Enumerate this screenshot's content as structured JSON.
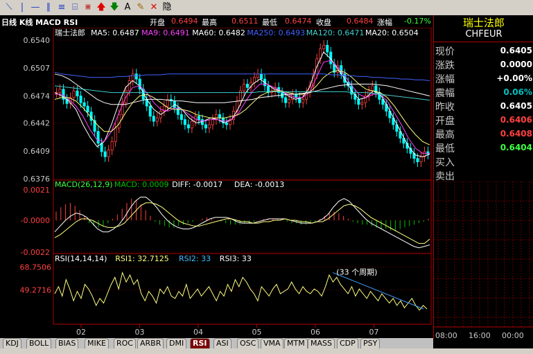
{
  "toolbar": {
    "icons": [
      "line-tool-icon",
      "vertical-line-icon",
      "horizontal-line-icon",
      "vertical-bars-icon",
      "parallel-lines-icon",
      "channel-icon",
      "fan-lines-icon",
      "arrow-up-icon",
      "arrow-down-icon",
      "text-icon",
      "eraser-icon",
      "delete-icon",
      "hide-icon"
    ],
    "glyphs": [
      "⟍",
      "|",
      "—",
      "∥",
      "≡",
      "⌸",
      "⋇",
      "🡅",
      "🡇",
      "A",
      "✎",
      "✕",
      "隐"
    ],
    "colors": [
      "#2040c0",
      "#2040c0",
      "#2040c0",
      "#2040c0",
      "#2040c0",
      "#2040c0",
      "#c02020",
      "#e00000",
      "#008000",
      "#000000",
      "#a06000",
      "#e00000",
      "#000000"
    ]
  },
  "header": {
    "chart_caption": "日线 K线 MACD RSI",
    "open_label": "开盘",
    "open_value": "0.6494",
    "high_label": "最高",
    "high_value": "0.6511",
    "low_label": "最低",
    "low_value": "0.6474",
    "close_label": "收盘",
    "close_value": "0.6484",
    "change_label": "涨幅",
    "change_value": "-0.17%"
  },
  "panel": {
    "name": "瑞士法郎",
    "code": "CHFEUR",
    "rows": [
      {
        "label": "现价",
        "value": "0.6405",
        "color": "#ffffff"
      },
      {
        "label": "涨跌",
        "value": "0.0000",
        "color": "#ffffff"
      },
      {
        "label": "涨幅",
        "value": "+0.00%",
        "color": "#ffffff"
      },
      {
        "label": "震幅",
        "value": "0.06%",
        "color": "#00c0c0"
      },
      {
        "label": "昨收",
        "value": "0.6405",
        "color": "#ffffff"
      },
      {
        "label": "开盘",
        "value": "0.6406",
        "color": "#ff4040"
      },
      {
        "label": "最高",
        "value": "0.6408",
        "color": "#ff4040"
      },
      {
        "label": "最低",
        "value": "0.6404",
        "color": "#40ff40"
      },
      {
        "label": "买入",
        "value": "",
        "color": "#ffffff"
      },
      {
        "label": "卖出",
        "value": "",
        "color": "#ffffff"
      }
    ],
    "time_labels": [
      "08:00",
      "16:00",
      "00:00"
    ]
  },
  "tabs": [
    "KDJ",
    "BOLL",
    "BIAS",
    "MIKE",
    "ROC",
    "ARBR",
    "DMI",
    "RSI",
    "ASI",
    "OSC",
    "VMA",
    "MTM",
    "MASS",
    "CDP",
    "PSY"
  ],
  "active_tab": "RSI",
  "chart_data": [
    {
      "type": "candlestick",
      "legend_name": "瑞士法郎",
      "ma_labels": [
        {
          "text": "MA5: 0.6487",
          "color": "#ffffff"
        },
        {
          "text": "MA9: 0.6491",
          "color": "#ff40ff"
        },
        {
          "text": "MA60: 0.6482",
          "color": "#ffffff"
        },
        {
          "text": "MA250: 0.6493",
          "color": "#4060ff"
        },
        {
          "text": "MA120: 0.6471",
          "color": "#40d0d0"
        },
        {
          "text": "MA20: 0.6504",
          "color": "#ffffff"
        }
      ],
      "y_ticks": [
        "0.6540",
        "0.6507",
        "0.6474",
        "0.6442",
        "0.6409",
        "0.6376"
      ],
      "ylim": [
        0.6376,
        0.654
      ],
      "x_ticks": [
        "02",
        "03",
        "04",
        "05",
        "06",
        "07"
      ],
      "close": [
        0.6478,
        0.6482,
        0.647,
        0.6465,
        0.6472,
        0.648,
        0.6474,
        0.6466,
        0.6462,
        0.6455,
        0.6445,
        0.6432,
        0.6418,
        0.6408,
        0.6402,
        0.641,
        0.642,
        0.6436,
        0.6452,
        0.6466,
        0.648,
        0.6492,
        0.65,
        0.6494,
        0.6482,
        0.647,
        0.6462,
        0.645,
        0.6444,
        0.6448,
        0.6456,
        0.6462,
        0.647,
        0.6468,
        0.646,
        0.6452,
        0.6446,
        0.644,
        0.6436,
        0.6444,
        0.645,
        0.6446,
        0.644,
        0.6436,
        0.644,
        0.6446,
        0.6452,
        0.6448,
        0.6442,
        0.644,
        0.6446,
        0.6456,
        0.6468,
        0.648,
        0.6488,
        0.6484,
        0.649,
        0.6496,
        0.65,
        0.6494,
        0.6486,
        0.6478,
        0.648,
        0.6484,
        0.6478,
        0.6472,
        0.6466,
        0.647,
        0.6476,
        0.6472,
        0.6466,
        0.647,
        0.6478,
        0.6486,
        0.65,
        0.6518,
        0.653,
        0.6534,
        0.6526,
        0.6512,
        0.6502,
        0.651,
        0.65,
        0.649,
        0.6486,
        0.6476,
        0.647,
        0.6464,
        0.6466,
        0.6474,
        0.648,
        0.6486,
        0.6478,
        0.647,
        0.6464,
        0.6456,
        0.6448,
        0.644,
        0.6432,
        0.6424,
        0.6418,
        0.6412,
        0.6406,
        0.64,
        0.6396,
        0.6402,
        0.6408,
        0.6405
      ],
      "ma_series": [
        {
          "name": "MA5",
          "color": "#ffffff",
          "values": [
            0.6478,
            0.6474,
            0.6468,
            0.6458,
            0.644,
            0.6425,
            0.6414,
            0.642,
            0.644,
            0.6464,
            0.6484,
            0.6492,
            0.6486,
            0.647,
            0.6458,
            0.6452,
            0.6458,
            0.6464,
            0.6458,
            0.6448,
            0.6442,
            0.6444,
            0.6448,
            0.6446,
            0.6442,
            0.6446,
            0.646,
            0.6478,
            0.6488,
            0.6494,
            0.6488,
            0.6482,
            0.648,
            0.6474,
            0.647,
            0.6472,
            0.6484,
            0.6508,
            0.6526,
            0.6518,
            0.6506,
            0.6494,
            0.648,
            0.647,
            0.6472,
            0.648,
            0.6476,
            0.6462,
            0.6446,
            0.643,
            0.6414,
            0.6404,
            0.6402,
            0.6405
          ]
        },
        {
          "name": "MA9",
          "color": "#ff40ff",
          "values": [
            0.6476,
            0.6476,
            0.647,
            0.6462,
            0.645,
            0.6434,
            0.6422,
            0.642,
            0.6432,
            0.6452,
            0.6472,
            0.6484,
            0.6486,
            0.6478,
            0.6466,
            0.6458,
            0.6456,
            0.646,
            0.6458,
            0.6452,
            0.6446,
            0.6444,
            0.6446,
            0.6446,
            0.6444,
            0.6446,
            0.6454,
            0.6468,
            0.648,
            0.6488,
            0.6488,
            0.6484,
            0.648,
            0.6476,
            0.6472,
            0.6472,
            0.6478,
            0.6496,
            0.6514,
            0.6516,
            0.6508,
            0.6498,
            0.6486,
            0.6476,
            0.6472,
            0.6476,
            0.6476,
            0.6468,
            0.6454,
            0.644,
            0.6424,
            0.6412,
            0.6406,
            0.6406
          ]
        },
        {
          "name": "MA20",
          "color": "#ffff80",
          "values": [
            0.647,
            0.6472,
            0.6472,
            0.6468,
            0.646,
            0.645,
            0.644,
            0.6432,
            0.6432,
            0.644,
            0.6454,
            0.6466,
            0.6474,
            0.6476,
            0.6472,
            0.6466,
            0.646,
            0.6458,
            0.6458,
            0.6456,
            0.6452,
            0.645,
            0.6448,
            0.6448,
            0.6448,
            0.645,
            0.6452,
            0.6458,
            0.6466,
            0.6474,
            0.6478,
            0.648,
            0.648,
            0.6478,
            0.6476,
            0.6476,
            0.6478,
            0.6486,
            0.6496,
            0.6502,
            0.6504,
            0.6502,
            0.6496,
            0.6488,
            0.6482,
            0.648,
            0.6478,
            0.6472,
            0.6462,
            0.645,
            0.6438,
            0.6428,
            0.642,
            0.6416
          ]
        },
        {
          "name": "MA60",
          "color": "#ffffff",
          "values": [
            0.65,
            0.6498,
            0.6494,
            0.6488,
            0.6482,
            0.6476,
            0.647,
            0.6466,
            0.6464,
            0.6464,
            0.6464,
            0.6466,
            0.6468,
            0.647,
            0.647,
            0.647,
            0.6469,
            0.6468,
            0.6468,
            0.6467,
            0.6466,
            0.6466,
            0.6466,
            0.6466,
            0.6466,
            0.6467,
            0.6468,
            0.6469,
            0.647,
            0.6472,
            0.6473,
            0.6474,
            0.6475,
            0.6476,
            0.6476,
            0.6477,
            0.6478,
            0.648,
            0.6482,
            0.6484,
            0.6486,
            0.6487,
            0.6488,
            0.6488,
            0.6488,
            0.6488,
            0.6487,
            0.6486,
            0.6484,
            0.6482,
            0.648,
            0.6478,
            0.6476,
            0.6474
          ]
        },
        {
          "name": "MA120",
          "color": "#40d0d0",
          "values": [
            0.6486,
            0.6485,
            0.6484,
            0.6483,
            0.6482,
            0.6481,
            0.648,
            0.6479,
            0.6478,
            0.6478,
            0.6478,
            0.6478,
            0.6478,
            0.6478,
            0.6478,
            0.6478,
            0.6478,
            0.6478,
            0.6478,
            0.6478,
            0.6478,
            0.6478,
            0.6478,
            0.6478,
            0.6478,
            0.6478,
            0.6478,
            0.6478,
            0.6478,
            0.6479,
            0.6479,
            0.6479,
            0.6479,
            0.6479,
            0.6479,
            0.6479,
            0.6479,
            0.6479,
            0.6479,
            0.6479,
            0.6479,
            0.6479,
            0.6478,
            0.6478,
            0.6478,
            0.6477,
            0.6476,
            0.6475,
            0.6474,
            0.6473,
            0.6472,
            0.6471,
            0.647,
            0.6469
          ]
        },
        {
          "name": "MA250",
          "color": "#4060ff",
          "values": [
            0.6502,
            0.65,
            0.6499,
            0.6498,
            0.6497,
            0.6496,
            0.6496,
            0.6496,
            0.6496,
            0.6497,
            0.6497,
            0.6498,
            0.6498,
            0.6499,
            0.6499,
            0.6499,
            0.65,
            0.65,
            0.65,
            0.65,
            0.65,
            0.65,
            0.65,
            0.65,
            0.65,
            0.65,
            0.65,
            0.65,
            0.65,
            0.65,
            0.65,
            0.65,
            0.65,
            0.65,
            0.65,
            0.65,
            0.65,
            0.65,
            0.65,
            0.6499,
            0.6499,
            0.6498,
            0.6498,
            0.6497,
            0.6497,
            0.6496,
            0.6496,
            0.6495,
            0.6495,
            0.6494,
            0.6494,
            0.6493,
            0.6493,
            0.6492
          ]
        }
      ]
    },
    {
      "type": "macd",
      "title": "MACD(26,12,9)",
      "legend": [
        {
          "text": "MACD: 0.0009",
          "color": "#00c000"
        },
        {
          "text": "DIFF: -0.0017",
          "color": "#ffffff"
        },
        {
          "text": "DEA: -0.0013",
          "color": "#ffffff"
        }
      ],
      "y_ticks": [
        "0.0021",
        "-0.0000",
        "-0.0022"
      ],
      "ylim": [
        -0.0022,
        0.0021
      ],
      "histogram": [
        0.0006,
        0.0009,
        0.0011,
        0.0012,
        0.001,
        0.0007,
        0.0003,
        -0.0002,
        -0.0004,
        -0.0005,
        -0.0004,
        -0.0002,
        0.0001,
        0.0004,
        0.0008,
        0.0012,
        0.0015,
        0.0014,
        0.0011,
        0.0007,
        0.0003,
        -0.0001,
        -0.0003,
        -0.0004,
        -0.0005,
        -0.0005,
        -0.0004,
        -0.0003,
        -0.0002,
        -0.0001,
        0.0,
        0.0001,
        0.0002,
        0.0001,
        0.0,
        -0.0001,
        -0.0002,
        -0.0003,
        -0.0003,
        -0.0003,
        -0.0002,
        -0.0002,
        -0.0001,
        0.0,
        0.0001,
        0.0001,
        0.0001,
        0.0001,
        0.0,
        -0.0001,
        -0.0002,
        -0.0002,
        -0.0003,
        -0.0003,
        -0.0002,
        -0.0001,
        0.0001,
        0.0003,
        0.0005,
        0.0006,
        0.0005,
        0.0003,
        0.0001,
        -0.0001,
        -0.0002,
        -0.0003,
        -0.0003,
        -0.0004,
        -0.0005,
        -0.0006,
        -0.0006,
        -0.0007,
        -0.0007,
        -0.0006,
        -0.0005,
        -0.0004,
        -0.0003,
        -0.0002,
        -0.0001,
        0.0001
      ],
      "diff": [
        -0.0008,
        -0.0004,
        0.0,
        0.0003,
        0.0005,
        0.0004,
        0.0002,
        -0.0002,
        -0.0006,
        -0.0008,
        -0.0008,
        -0.0006,
        -0.0003,
        0.0002,
        0.0008,
        0.0013,
        0.0016,
        0.0016,
        0.0013,
        0.0009,
        0.0004,
        0.0,
        -0.0003,
        -0.0005,
        -0.0006,
        -0.0006,
        -0.0005,
        -0.0003,
        -0.0001,
        0.0001,
        0.0002,
        0.0002,
        0.0002,
        0.0001,
        -0.0001,
        -0.0002,
        -0.0002,
        -0.0002,
        -0.0001,
        0.0,
        0.0001,
        0.0001,
        0.0001,
        0.0001,
        0.0,
        -0.0001,
        -0.0002,
        -0.0002,
        -0.0002,
        -0.0001,
        0.0001,
        0.0004,
        0.0009,
        0.0013,
        0.0015,
        0.0013,
        0.0009,
        0.0005,
        0.0001,
        -0.0002,
        -0.0004,
        -0.0006,
        -0.0008,
        -0.001,
        -0.0012,
        -0.0014,
        -0.0016,
        -0.0018,
        -0.0019,
        -0.0018,
        -0.0017
      ],
      "dea": [
        -0.0012,
        -0.001,
        -0.0007,
        -0.0004,
        -0.0001,
        0.0001,
        0.0001,
        0.0,
        -0.0002,
        -0.0004,
        -0.0005,
        -0.0005,
        -0.0004,
        -0.0002,
        0.0002,
        0.0006,
        0.001,
        0.0012,
        0.0012,
        0.0011,
        0.0009,
        0.0006,
        0.0003,
        0.0,
        -0.0002,
        -0.0003,
        -0.0004,
        -0.0004,
        -0.0003,
        -0.0002,
        -0.0001,
        0.0,
        0.0001,
        0.0001,
        0.0,
        -0.0001,
        -0.0001,
        -0.0002,
        -0.0002,
        -0.0001,
        -0.0001,
        0.0,
        0.0,
        0.0001,
        0.0,
        0.0,
        -0.0001,
        -0.0001,
        -0.0002,
        -0.0001,
        -0.0001,
        0.0001,
        0.0004,
        0.0007,
        0.001,
        0.0011,
        0.001,
        0.0008,
        0.0005,
        0.0002,
        0.0,
        -0.0002,
        -0.0004,
        -0.0006,
        -0.0008,
        -0.001,
        -0.0012,
        -0.0014,
        -0.0016,
        -0.0016,
        -0.0013
      ]
    },
    {
      "type": "line",
      "title": "RSI(14,14,14)",
      "legend": [
        {
          "text": "RSI1: 32.7125",
          "color": "#ffff80"
        },
        {
          "text": "RSI2: 33",
          "color": "#40c0ff"
        },
        {
          "text": "RSI3: 33",
          "color": "#ffffff"
        }
      ],
      "y_ticks": [
        "68.7506",
        "49.2716"
      ],
      "ylim": [
        20,
        72
      ],
      "annotation": "(33 个周期)",
      "values": [
        46,
        52,
        44,
        58,
        50,
        40,
        48,
        42,
        54,
        50,
        44,
        36,
        42,
        38,
        46,
        54,
        60,
        50,
        64,
        56,
        62,
        54,
        58,
        46,
        40,
        48,
        44,
        38,
        50,
        46,
        52,
        44,
        42,
        48,
        44,
        54,
        42,
        46,
        50,
        44,
        48,
        52,
        46,
        40,
        48,
        44,
        54,
        48,
        58,
        52,
        60,
        56,
        50,
        46,
        40,
        52,
        48,
        44,
        50,
        54,
        46,
        48,
        50,
        56,
        50,
        46,
        52,
        48,
        46,
        50,
        48,
        44,
        52,
        62,
        56,
        60,
        54,
        50,
        46,
        52,
        44,
        50,
        46,
        42,
        48,
        44,
        40,
        46,
        42,
        38,
        42,
        36,
        40,
        34,
        38,
        42,
        36,
        32,
        36,
        33
      ],
      "trendline": [
        [
          0.74,
          64
        ],
        [
          0.98,
          33
        ]
      ]
    }
  ]
}
